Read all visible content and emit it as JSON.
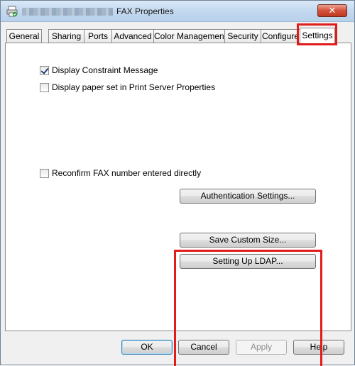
{
  "window": {
    "title": "FAX Properties",
    "close_label": "✕"
  },
  "tabs": [
    {
      "label": "General",
      "active": false
    },
    {
      "label": "Sharing",
      "active": false
    },
    {
      "label": "Ports",
      "active": false
    },
    {
      "label": "Advanced",
      "active": false
    },
    {
      "label": "Color Management",
      "active": false
    },
    {
      "label": "Security",
      "active": false
    },
    {
      "label": "Configure",
      "active": false
    },
    {
      "label": "Settings",
      "active": true
    }
  ],
  "settings": {
    "display_constraint_message": {
      "label": "Display Constraint Message",
      "checked": true
    },
    "display_paper_set": {
      "label": "Display paper set in Print Server Properties",
      "checked": false
    },
    "reconfirm_fax": {
      "label": "Reconfirm FAX number entered directly",
      "checked": false
    },
    "authentication_button": "Authentication Settings...",
    "save_custom_size_button": "Save Custom Size...",
    "setting_up_ldap_button": "Setting Up LDAP..."
  },
  "footer": {
    "ok": "OK",
    "cancel": "Cancel",
    "apply": "Apply",
    "help": "Help"
  },
  "colors": {
    "highlight": "#e21b1b"
  }
}
